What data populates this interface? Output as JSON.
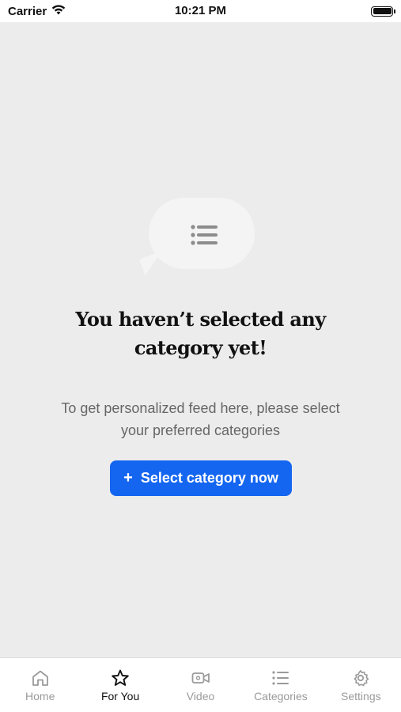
{
  "status_bar": {
    "carrier": "Carrier",
    "time": "10:21 PM",
    "icons": [
      "wifi-icon",
      "battery-icon"
    ]
  },
  "empty_state": {
    "icon": "list-bubble-icon",
    "title_line1": "You haven’t selected any",
    "title_line2": "category yet!",
    "subtitle_line1": "To get personalized feed here, please select",
    "subtitle_line2": "your preferred categories",
    "button_icon": "+",
    "button_label": "Select category now"
  },
  "tab_bar": {
    "active": "For You",
    "tabs": [
      {
        "label": "Home",
        "icon": "home-icon"
      },
      {
        "label": "For You",
        "icon": "star-icon"
      },
      {
        "label": "Video",
        "icon": "video-icon"
      },
      {
        "label": "Categories",
        "icon": "list-icon"
      },
      {
        "label": "Settings",
        "icon": "gear-icon"
      }
    ]
  },
  "colors": {
    "accent": "#1466f0",
    "background": "#ececec",
    "inactive_tab": "#9a9a9a"
  }
}
